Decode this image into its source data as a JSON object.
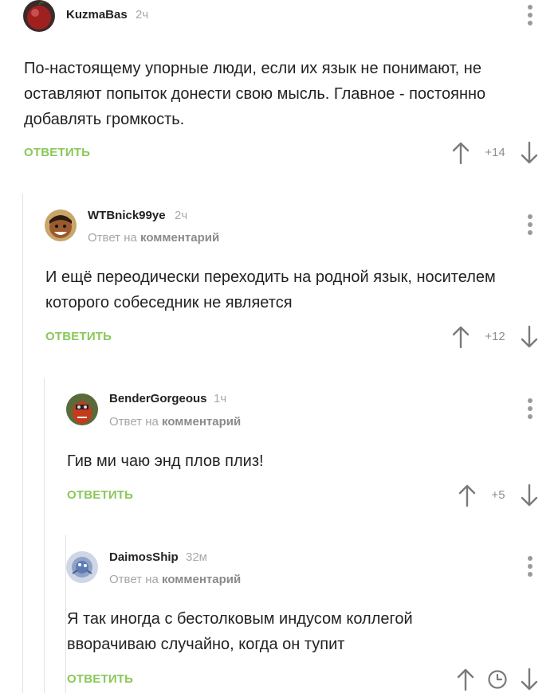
{
  "comments": [
    {
      "username": "KuzmaBas",
      "time": "2ч",
      "text": "По-настоящему упорные люди, если их язык не понимают, не оставляют попыток донести свою мысль. Главное - постоянно добавлять громкость.",
      "reply_label": "ОТВЕТИТЬ",
      "rating": "+14"
    },
    {
      "username": "WTBnick99ye",
      "time": "2ч",
      "reply_prefix": "Ответ на",
      "reply_target": "комментарий",
      "text": "И ещё переодически переходить на родной язык, носителем которого собеседник не является",
      "reply_label": "ОТВЕТИТЬ",
      "rating": "+12"
    },
    {
      "username": "BenderGorgeous",
      "time": "1ч",
      "reply_prefix": "Ответ на",
      "reply_target": "комментарий",
      "text": "Гив ми чаю энд плов плиз!",
      "reply_label": "ОТВЕТИТЬ",
      "rating": "+5"
    },
    {
      "username": "DaimosShip",
      "time": "32м",
      "reply_prefix": "Ответ на",
      "reply_target": "комментарий",
      "text": "Я так иногда с бестолковым индусом коллегой вворачиваю случайно, когда он тупит",
      "reply_label": "ОТВЕТИТЬ",
      "rating_pending_icon": "clock-icon"
    }
  ],
  "colors": {
    "reply_green": "#8ac858",
    "muted_text": "#a9a9a9",
    "thread_line": "#e2e2e2"
  }
}
